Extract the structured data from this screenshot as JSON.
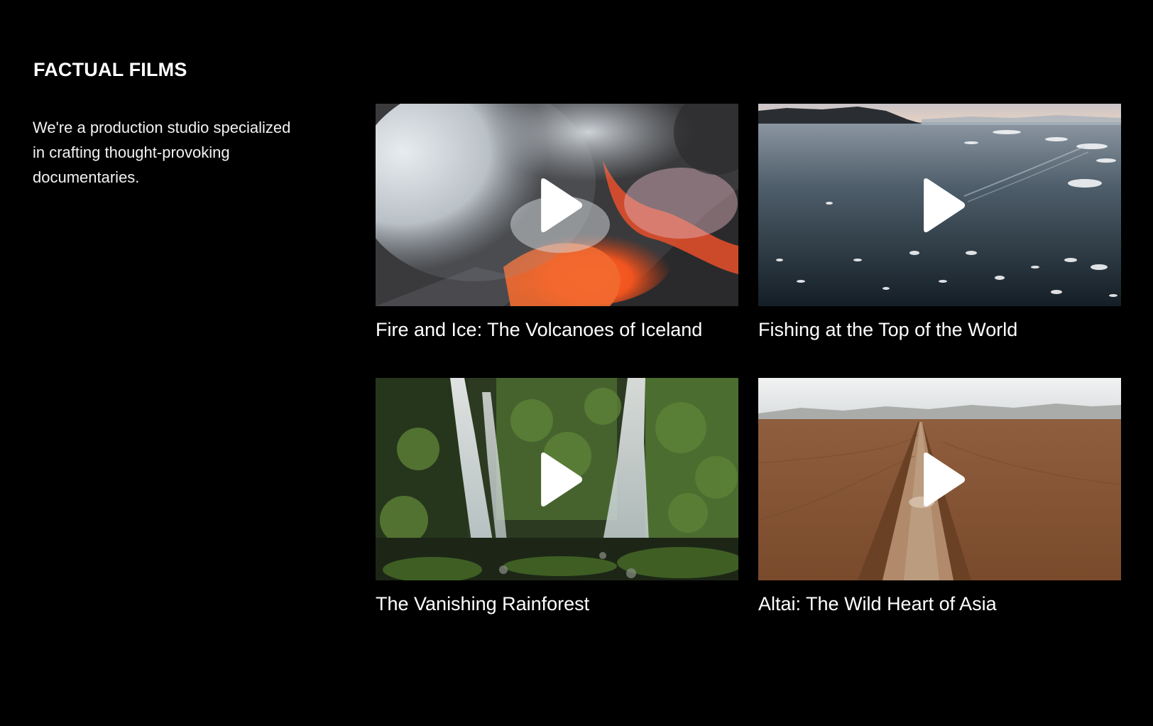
{
  "brand": {
    "name": "FACTUAL FILMS",
    "tagline": "We're a production studio specialized in crafting thought-provoking documentaries."
  },
  "films": [
    {
      "title": "Fire and Ice: The Volcanoes of Iceland",
      "thumbnail": "volcano-lava-smoke",
      "icon": "play-icon"
    },
    {
      "title": "Fishing at the Top of the World",
      "thumbnail": "arctic-sea-ice",
      "icon": "play-icon"
    },
    {
      "title": "The Vanishing Rainforest",
      "thumbnail": "rainforest-waterfalls",
      "icon": "play-icon"
    },
    {
      "title": "Altai: The Wild Heart of Asia",
      "thumbnail": "steppe-dirt-road",
      "icon": "play-icon"
    }
  ],
  "colors": {
    "background": "#000000",
    "text": "#ffffff"
  }
}
